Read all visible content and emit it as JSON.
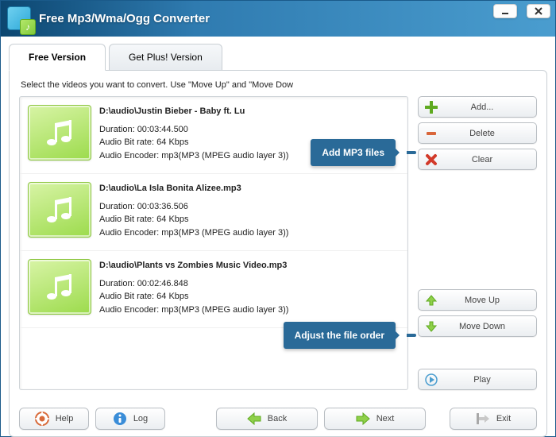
{
  "app_title": "Free Mp3/Wma/Ogg Converter",
  "tabs": {
    "free": "Free Version",
    "plus": "Get Plus! Version"
  },
  "instruction": "Select the videos you want to convert. Use \"Move Up\" and \"Move Dow",
  "callouts": {
    "add": "Add MP3 files",
    "order": "Adjust the file order"
  },
  "files": [
    {
      "path": "D:\\audio\\Justin Bieber - Baby ft. Lu",
      "duration": "Duration: 00:03:44.500",
      "bitrate": "Audio Bit rate: 64 Kbps",
      "encoder": "Audio Encoder: mp3(MP3 (MPEG audio layer 3))"
    },
    {
      "path": "D:\\audio\\La Isla Bonita Alizee.mp3",
      "duration": "Duration: 00:03:36.506",
      "bitrate": "Audio Bit rate: 64 Kbps",
      "encoder": "Audio Encoder: mp3(MP3 (MPEG audio layer 3))"
    },
    {
      "path": "D:\\audio\\Plants vs Zombies Music Video.mp3",
      "duration": "Duration: 00:02:46.848",
      "bitrate": "Audio Bit rate: 64 Kbps",
      "encoder": "Audio Encoder: mp3(MP3 (MPEG audio layer 3))"
    }
  ],
  "side": {
    "add": "Add...",
    "delete": "Delete",
    "clear": "Clear",
    "moveup": "Move Up",
    "movedown": "Move Down",
    "play": "Play"
  },
  "bottom": {
    "help": "Help",
    "log": "Log",
    "back": "Back",
    "next": "Next",
    "exit": "Exit"
  }
}
